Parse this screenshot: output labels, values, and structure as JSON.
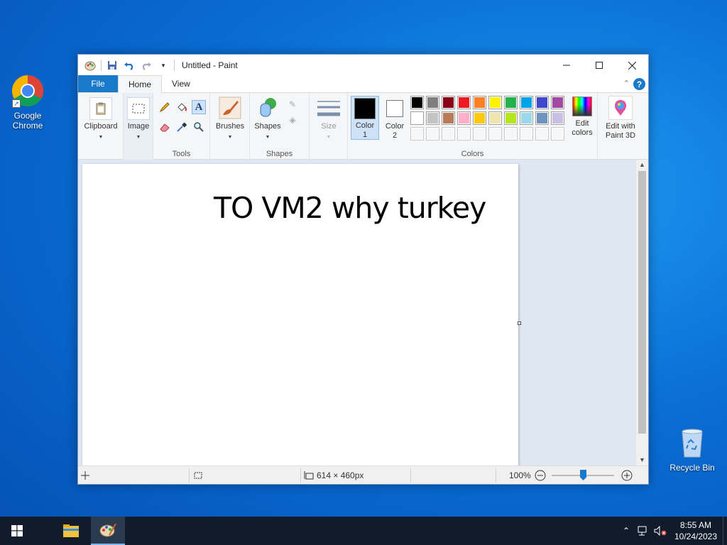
{
  "desktop": {
    "icons": [
      {
        "label_line1": "Google",
        "label_line2": "Chrome"
      },
      {
        "label": "Recycle Bin"
      }
    ]
  },
  "window": {
    "title": "Untitled - Paint",
    "tabs": [
      "File",
      "Home",
      "View"
    ],
    "ribbon": {
      "clipboard": "Clipboard",
      "image": "Image",
      "tools_group": "Tools",
      "brushes": "Brushes",
      "shapes": "Shapes",
      "shapes_group": "Shapes",
      "size": "Size",
      "color1_line1": "Color",
      "color1_line2": "1",
      "color2_line1": "Color",
      "color2_line2": "2",
      "colors_group": "Colors",
      "edit_colors_line1": "Edit",
      "edit_colors_line2": "colors",
      "edit_3d_line1": "Edit with",
      "edit_3d_line2": "Paint 3D"
    },
    "palette": {
      "row1": [
        "#000000",
        "#7f7f7f",
        "#880015",
        "#ed1c24",
        "#ff7f27",
        "#fff200",
        "#22b14c",
        "#00a2e8",
        "#3f48cc",
        "#a349a4"
      ],
      "row2": [
        "#ffffff",
        "#c3c3c3",
        "#b97a57",
        "#ffaec9",
        "#ffc90e",
        "#efe4b0",
        "#b5e61d",
        "#99d9ea",
        "#7092be",
        "#c8bfe7"
      ],
      "row3": [
        "#f5f6f7",
        "#f5f6f7",
        "#f5f6f7",
        "#f5f6f7",
        "#f5f6f7",
        "#f5f6f7",
        "#f5f6f7",
        "#f5f6f7",
        "#f5f6f7",
        "#f5f6f7"
      ],
      "color1": "#000000",
      "color2": "#ffffff"
    },
    "canvas_text": "TO VM2 why turkey",
    "status": {
      "dimensions": "614 × 460px",
      "zoom": "100%"
    }
  },
  "taskbar": {
    "time": "8:55 AM",
    "date": "10/24/2023"
  },
  "colors": {
    "accent": "#1979ca",
    "taskbar": "#101b2b"
  }
}
